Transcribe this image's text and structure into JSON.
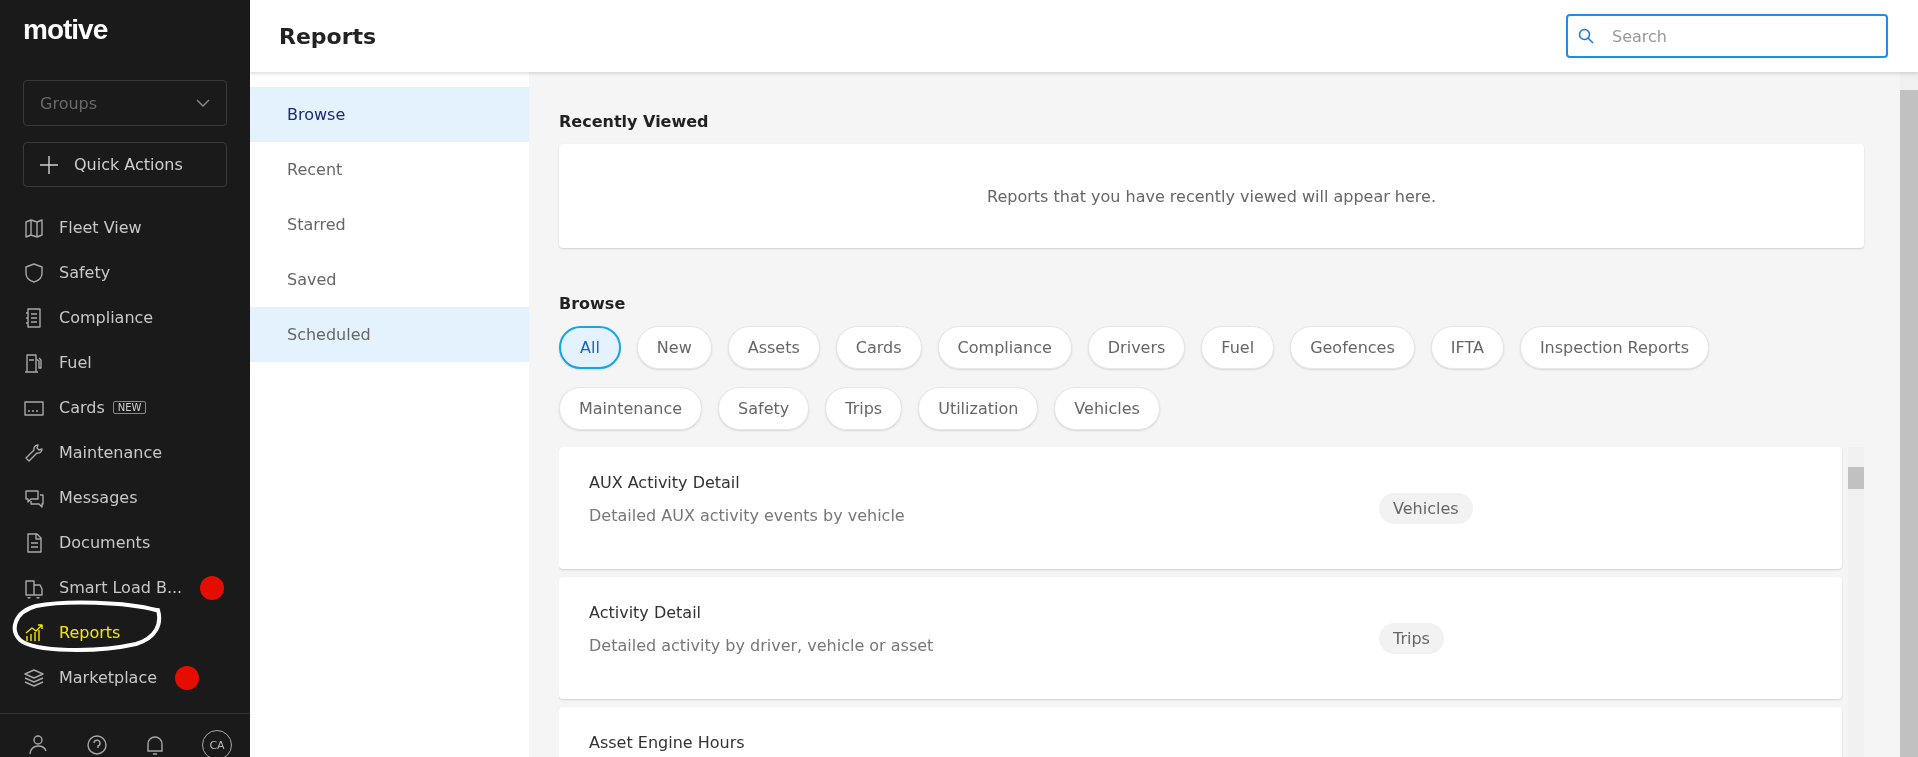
{
  "sidebar": {
    "logo": "motive",
    "groups": {
      "placeholder": "Groups"
    },
    "quick_actions": "Quick Actions",
    "items": [
      {
        "label": "Fleet View",
        "selected": false,
        "notification": false
      },
      {
        "label": "Safety",
        "selected": false,
        "notification": false
      },
      {
        "label": "Compliance",
        "selected": false,
        "notification": false
      },
      {
        "label": "Fuel",
        "selected": false,
        "notification": false
      },
      {
        "label": "Cards",
        "badge": "NEW",
        "selected": false,
        "notification": false
      },
      {
        "label": "Maintenance",
        "selected": false,
        "notification": false
      },
      {
        "label": "Messages",
        "selected": false,
        "notification": false
      },
      {
        "label": "Documents",
        "selected": false,
        "notification": false
      },
      {
        "label": "Smart Load B...",
        "selected": false,
        "notification": true
      },
      {
        "label": "Reports",
        "selected": true,
        "notification": false
      },
      {
        "label": "Marketplace",
        "selected": false,
        "notification": true
      }
    ],
    "avatar": "CA"
  },
  "header": {
    "title": "Reports",
    "search": {
      "placeholder": "Search"
    }
  },
  "subnav": [
    {
      "label": "Browse",
      "selected": true,
      "highlighted": true
    },
    {
      "label": "Recent",
      "selected": false,
      "highlighted": false
    },
    {
      "label": "Starred",
      "selected": false,
      "highlighted": false
    },
    {
      "label": "Saved",
      "selected": false,
      "highlighted": false
    },
    {
      "label": "Scheduled",
      "selected": false,
      "highlighted": true
    }
  ],
  "recently_viewed": {
    "title": "Recently Viewed",
    "empty_text": "Reports that you have recently viewed will appear here."
  },
  "browse": {
    "title": "Browse",
    "chips": [
      {
        "label": "All",
        "selected": true
      },
      {
        "label": "New",
        "selected": false
      },
      {
        "label": "Assets",
        "selected": false
      },
      {
        "label": "Cards",
        "selected": false
      },
      {
        "label": "Compliance",
        "selected": false
      },
      {
        "label": "Drivers",
        "selected": false
      },
      {
        "label": "Fuel",
        "selected": false
      },
      {
        "label": "Geofences",
        "selected": false
      },
      {
        "label": "IFTA",
        "selected": false
      },
      {
        "label": "Inspection Reports",
        "selected": false
      },
      {
        "label": "Maintenance",
        "selected": false
      },
      {
        "label": "Safety",
        "selected": false
      },
      {
        "label": "Trips",
        "selected": false
      },
      {
        "label": "Utilization",
        "selected": false
      },
      {
        "label": "Vehicles",
        "selected": false
      }
    ]
  },
  "reports": [
    {
      "title": "AUX Activity Detail",
      "description": "Detailed AUX activity events by vehicle",
      "tag": "Vehicles"
    },
    {
      "title": "Activity Detail",
      "description": "Detailed activity by driver, vehicle or asset",
      "tag": "Trips"
    },
    {
      "title": "Asset Engine Hours"
    }
  ]
}
